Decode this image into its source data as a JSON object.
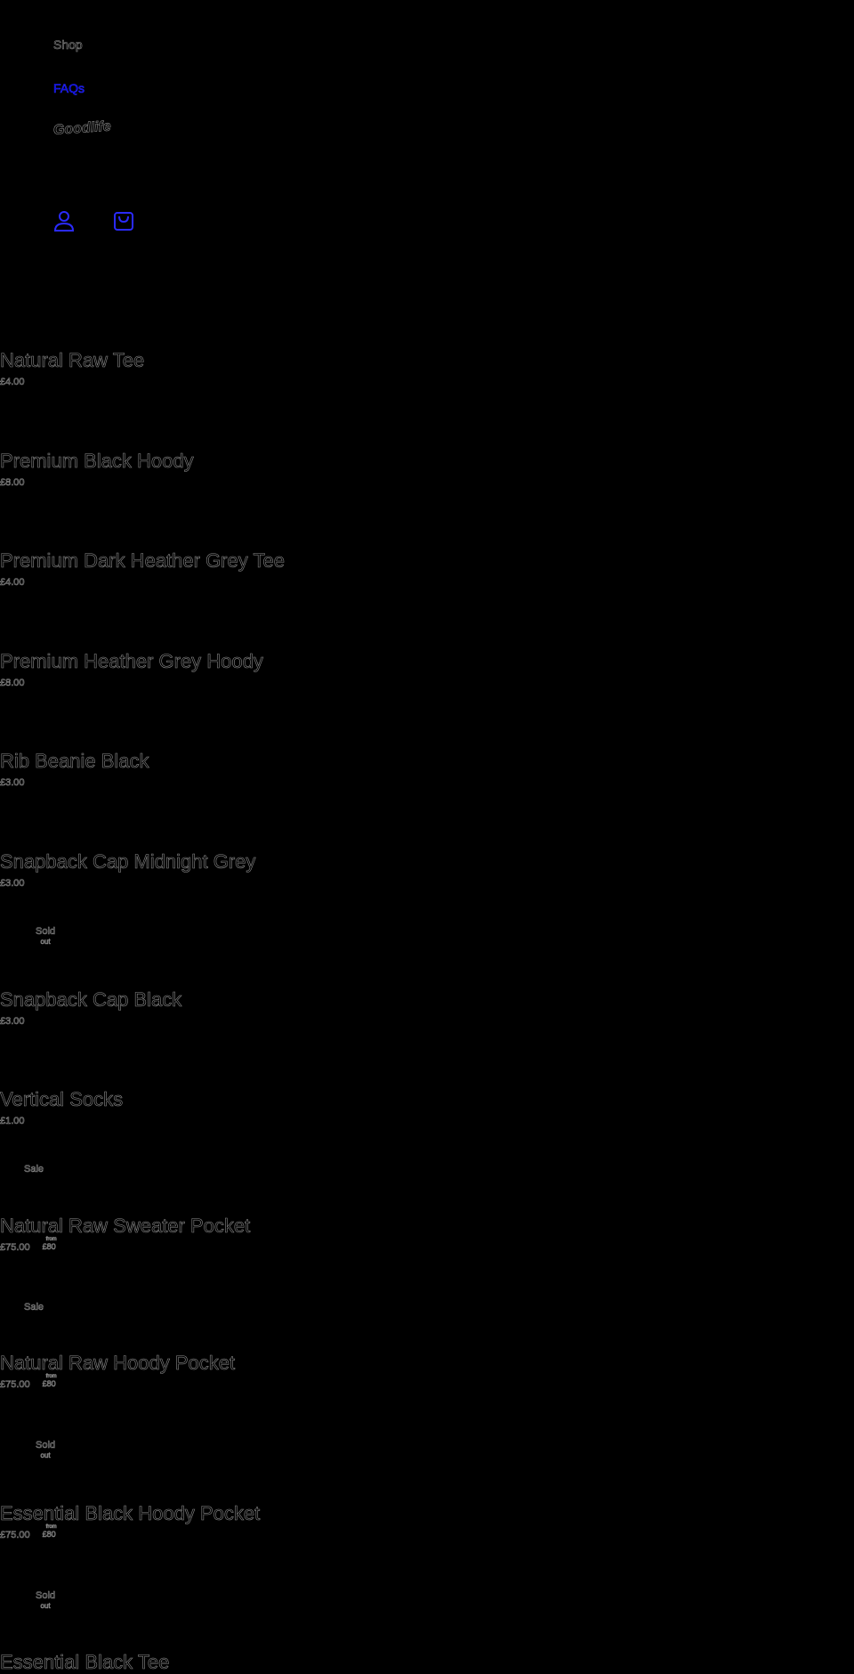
{
  "header": {
    "nav_shop": "Shop",
    "nav_faqs": "FAQs",
    "logo_text": "Goodlife",
    "account_icon": "account-icon",
    "cart_icon": "cart-icon"
  },
  "colors": {
    "background": "#000000",
    "link": "#0000c8",
    "outline": "#8a8a8a"
  },
  "badges": {
    "sold_out": {
      "title": "Sold",
      "sub": "out"
    },
    "sale": {
      "title": "Sale"
    }
  },
  "products": [
    {
      "title": "Natural Raw Tee",
      "price": "£4.00"
    },
    {
      "title": "Premium Black Hoody",
      "price": "£8.00"
    },
    {
      "title": "Premium Dark Heather Grey Tee",
      "price": "£4.00"
    },
    {
      "title": "Premium Heather Grey Hoody",
      "price": "£8.00"
    },
    {
      "title": "Rib Beanie Black",
      "price": "£3.00"
    },
    {
      "title": "Snapback Cap Midnight Grey",
      "price": "£3.00"
    },
    {
      "title": "Snapback Cap Black",
      "price": "£3.00"
    },
    {
      "title": "Vertical Socks",
      "price": "£1.00"
    },
    {
      "title": "Natural Raw Sweater Pocket",
      "price": "£75.00",
      "compare_label": "from",
      "compare_price": "£80"
    },
    {
      "title": "Natural Raw Hoody Pocket",
      "price": "£75.00",
      "compare_label": "from",
      "compare_price": "£80"
    },
    {
      "title": "Essential Black Hoody Pocket",
      "price": "£75.00",
      "compare_label": "from",
      "compare_price": "£80"
    },
    {
      "title": "Essential Black Tee"
    }
  ]
}
